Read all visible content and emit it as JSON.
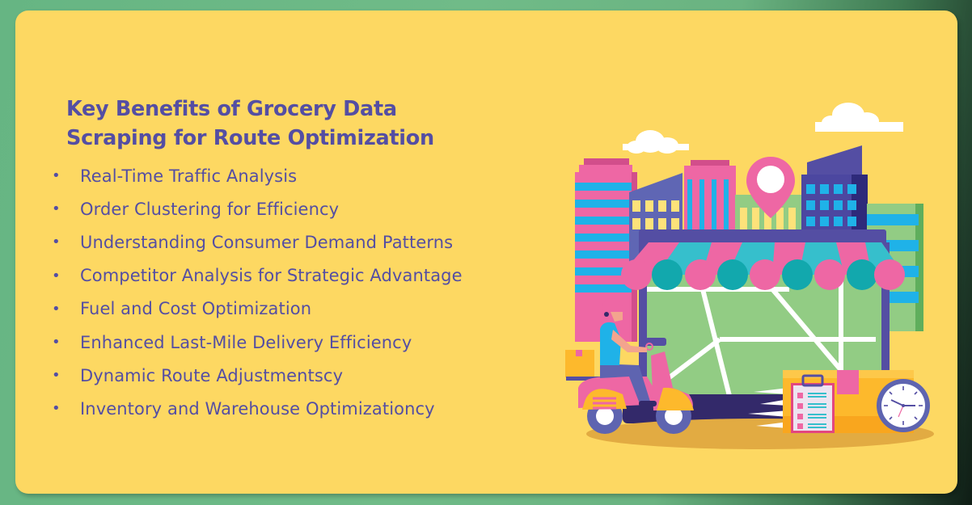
{
  "heading": {
    "line1": "Key Benefits of Grocery Data",
    "line2": "Scraping for Route Optimization"
  },
  "benefits": [
    {
      "bullet": "•",
      "label": "Real-Time Traffic Analysis"
    },
    {
      "bullet": "•",
      "label": "Order Clustering for Efficiency"
    },
    {
      "bullet": "•",
      "label": "Understanding Consumer Demand Patterns"
    },
    {
      "bullet": "•",
      "label": "Competitor Analysis for Strategic Advantage"
    },
    {
      "bullet": "•",
      "label": "Fuel and Cost Optimization"
    },
    {
      "bullet": "•",
      "label": "Enhanced Last-Mile Delivery Efficiency"
    },
    {
      "bullet": "•",
      "label": "Dynamic Route Adjustmentscy"
    },
    {
      "bullet": "•",
      "label": "Inventory and Warehouse Optimizationcy"
    }
  ],
  "illustration": {
    "subject": "delivery scooter in front of storefront with city map, location pin, clipboard and clock",
    "colors": {
      "background": "#fdd862",
      "text": "#544ea3",
      "pink": "#ee67a4",
      "teal": "#36bfcc",
      "purple": "#544ea3",
      "green": "#92cc84",
      "orange": "#fdb92c"
    }
  }
}
